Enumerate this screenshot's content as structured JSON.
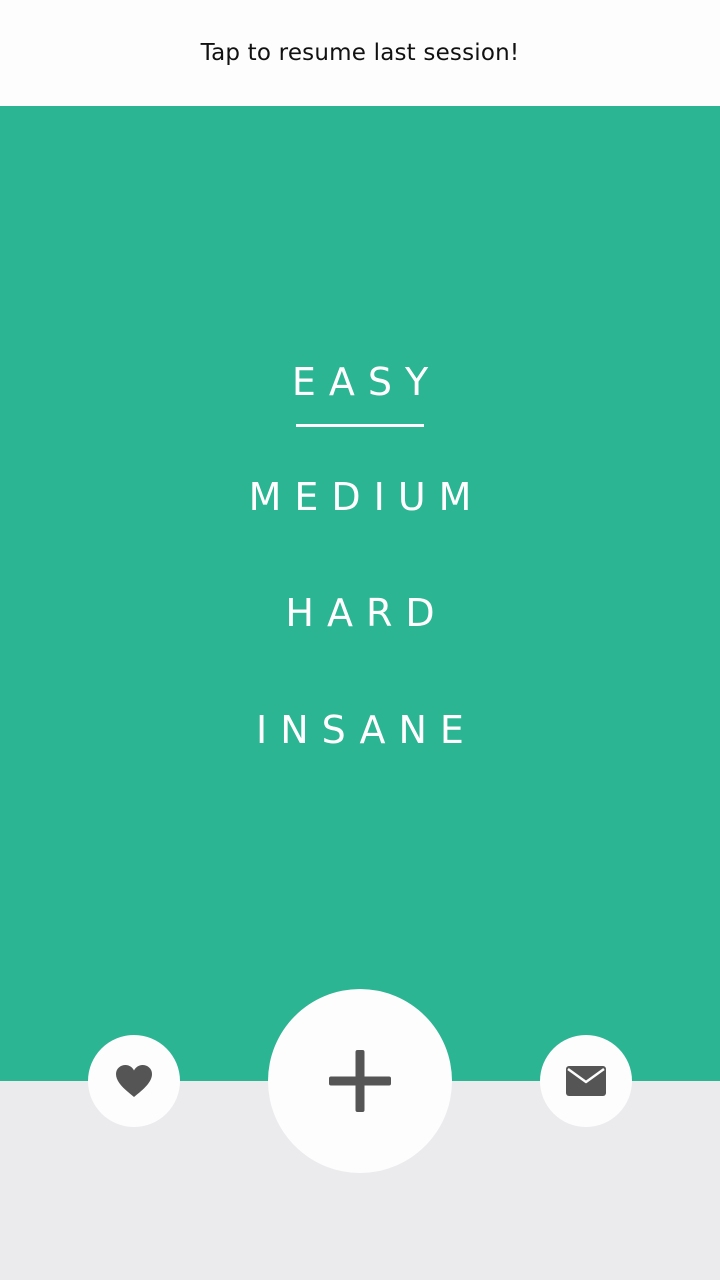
{
  "resume_bar": {
    "label": "Tap to resume last session!"
  },
  "difficulty_menu": {
    "selected": "EASY",
    "options": [
      "EASY",
      "MEDIUM",
      "HARD",
      "INSANE"
    ]
  },
  "bottom_actions": {
    "left": {
      "icon": "heart-icon"
    },
    "center": {
      "icon": "plus-icon"
    },
    "right": {
      "icon": "mail-icon"
    }
  },
  "colors": {
    "accent": "#2bb592",
    "top_bar": "#fdfdfe",
    "bottom_bar": "#ebeaec",
    "icon": "#555555",
    "menu_text": "#ffffff"
  }
}
